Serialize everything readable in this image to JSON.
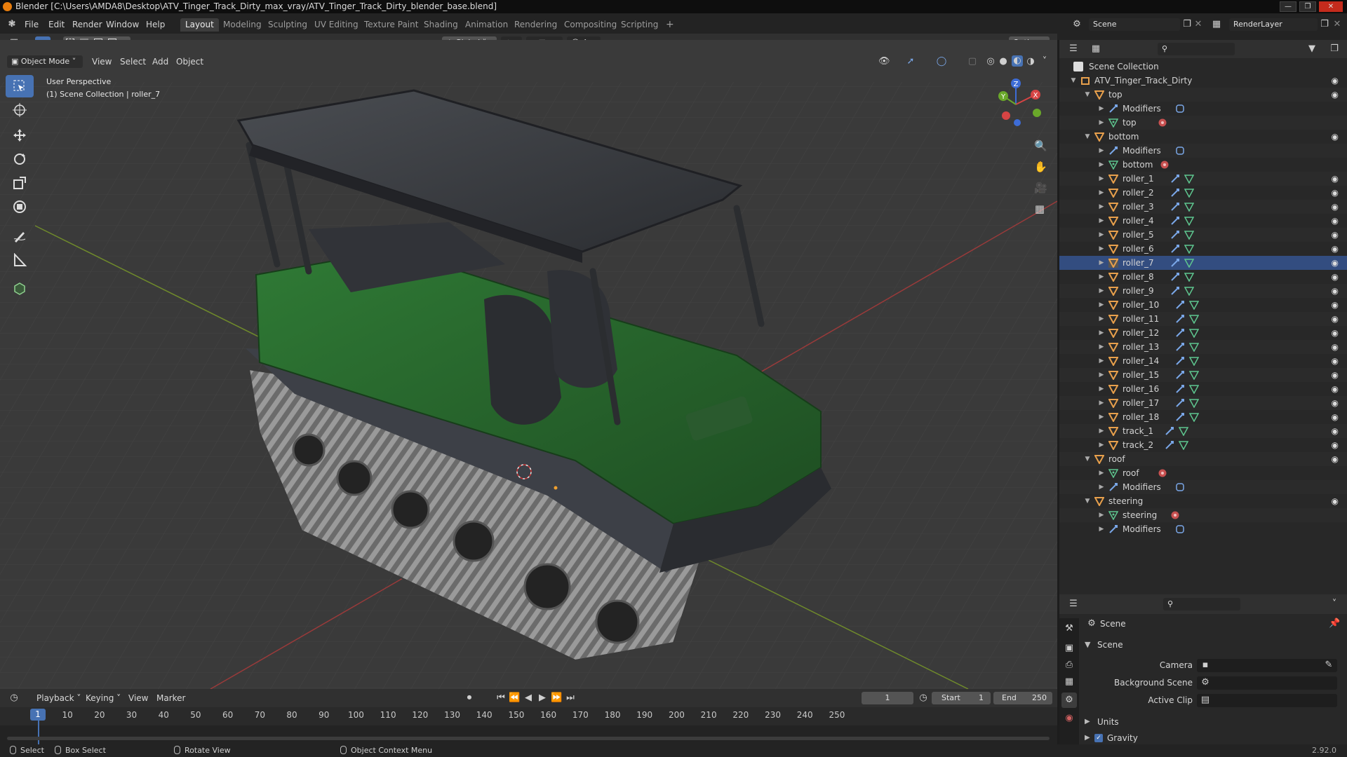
{
  "title_bar": {
    "text": "Blender [C:\\Users\\AMDA8\\Desktop\\ATV_Tinger_Track_Dirty_max_vray/ATV_Tinger_Track_Dirty_blender_base.blend]"
  },
  "menu": [
    "File",
    "Edit",
    "Render",
    "Window",
    "Help"
  ],
  "workspaces": [
    "Layout",
    "Modeling",
    "Sculpting",
    "UV Editing",
    "Texture Paint",
    "Shading",
    "Animation",
    "Rendering",
    "Compositing",
    "Scripting"
  ],
  "workspace_add": "+",
  "scene_selector": {
    "value": "Scene"
  },
  "view_layer_selector": {
    "value": "RenderLayer"
  },
  "tool_header": {
    "orientation": "Global",
    "options": "Options"
  },
  "viewport_header": {
    "mode": "Object Mode",
    "menus": [
      "View",
      "Select",
      "Add",
      "Object"
    ]
  },
  "viewport_overlay_text": {
    "line1": "User Perspective",
    "line2": "(1) Scene Collection | roller_7"
  },
  "gizmo": {
    "x": "X",
    "y": "Y",
    "z": "Z"
  },
  "outliner": {
    "root": "Scene Collection",
    "items": [
      {
        "label": "ATV_Tinger_Track_Dirty",
        "depth": 0,
        "type": "collection",
        "expanded": true,
        "eye": true
      },
      {
        "label": "top",
        "depth": 1,
        "type": "object",
        "expanded": true,
        "eye": true
      },
      {
        "label": "Modifiers",
        "depth": 2,
        "type": "modifiers",
        "expanded": false,
        "eye": false
      },
      {
        "label": "top",
        "depth": 2,
        "type": "mesh",
        "expanded": false,
        "eye": false
      },
      {
        "label": "bottom",
        "depth": 1,
        "type": "object",
        "expanded": true,
        "eye": true
      },
      {
        "label": "Modifiers",
        "depth": 2,
        "type": "modifiers",
        "expanded": false,
        "eye": false
      },
      {
        "label": "bottom",
        "depth": 2,
        "type": "mesh",
        "expanded": false,
        "eye": false
      },
      {
        "label": "roller_1",
        "depth": 2,
        "type": "object",
        "expanded": false,
        "eye": true
      },
      {
        "label": "roller_2",
        "depth": 2,
        "type": "object",
        "expanded": false,
        "eye": true
      },
      {
        "label": "roller_3",
        "depth": 2,
        "type": "object",
        "expanded": false,
        "eye": true
      },
      {
        "label": "roller_4",
        "depth": 2,
        "type": "object",
        "expanded": false,
        "eye": true
      },
      {
        "label": "roller_5",
        "depth": 2,
        "type": "object",
        "expanded": false,
        "eye": true
      },
      {
        "label": "roller_6",
        "depth": 2,
        "type": "object",
        "expanded": false,
        "eye": true
      },
      {
        "label": "roller_7",
        "depth": 2,
        "type": "object",
        "expanded": false,
        "eye": true,
        "active": true
      },
      {
        "label": "roller_8",
        "depth": 2,
        "type": "object",
        "expanded": false,
        "eye": true
      },
      {
        "label": "roller_9",
        "depth": 2,
        "type": "object",
        "expanded": false,
        "eye": true
      },
      {
        "label": "roller_10",
        "depth": 2,
        "type": "object",
        "expanded": false,
        "eye": true
      },
      {
        "label": "roller_11",
        "depth": 2,
        "type": "object",
        "expanded": false,
        "eye": true
      },
      {
        "label": "roller_12",
        "depth": 2,
        "type": "object",
        "expanded": false,
        "eye": true
      },
      {
        "label": "roller_13",
        "depth": 2,
        "type": "object",
        "expanded": false,
        "eye": true
      },
      {
        "label": "roller_14",
        "depth": 2,
        "type": "object",
        "expanded": false,
        "eye": true
      },
      {
        "label": "roller_15",
        "depth": 2,
        "type": "object",
        "expanded": false,
        "eye": true
      },
      {
        "label": "roller_16",
        "depth": 2,
        "type": "object",
        "expanded": false,
        "eye": true
      },
      {
        "label": "roller_17",
        "depth": 2,
        "type": "object",
        "expanded": false,
        "eye": true
      },
      {
        "label": "roller_18",
        "depth": 2,
        "type": "object",
        "expanded": false,
        "eye": true
      },
      {
        "label": "track_1",
        "depth": 2,
        "type": "object",
        "expanded": false,
        "eye": true
      },
      {
        "label": "track_2",
        "depth": 2,
        "type": "object",
        "expanded": false,
        "eye": true
      },
      {
        "label": "roof",
        "depth": 1,
        "type": "object",
        "expanded": true,
        "eye": true
      },
      {
        "label": "roof",
        "depth": 2,
        "type": "mesh",
        "expanded": false,
        "eye": false
      },
      {
        "label": "Modifiers",
        "depth": 2,
        "type": "modifiers",
        "expanded": false,
        "eye": false
      },
      {
        "label": "steering",
        "depth": 1,
        "type": "object",
        "expanded": true,
        "eye": true
      },
      {
        "label": "steering",
        "depth": 2,
        "type": "mesh",
        "expanded": false,
        "eye": false
      },
      {
        "label": "Modifiers",
        "depth": 2,
        "type": "modifiers",
        "expanded": false,
        "eye": false
      }
    ]
  },
  "properties": {
    "context": "Scene",
    "panel": "Scene",
    "fields": [
      {
        "label": "Camera",
        "value": ""
      },
      {
        "label": "Background Scene",
        "value": ""
      },
      {
        "label": "Active Clip",
        "value": ""
      }
    ],
    "collapsed_panels": [
      "Units",
      "Gravity"
    ]
  },
  "timeline": {
    "menus": [
      "Playback",
      "Keying",
      "View",
      "Marker"
    ],
    "current_frame": "1",
    "start_label": "Start",
    "start": "1",
    "end_label": "End",
    "end": "250",
    "ticks": [
      "1",
      "10",
      "20",
      "30",
      "40",
      "50",
      "60",
      "70",
      "80",
      "90",
      "100",
      "110",
      "120",
      "130",
      "140",
      "150",
      "160",
      "170",
      "180",
      "190",
      "200",
      "210",
      "220",
      "230",
      "240",
      "250"
    ]
  },
  "status_bar": {
    "select": "Select",
    "box_select": "Box Select",
    "rotate": "Rotate View",
    "context_menu": "Object Context Menu",
    "version": "2.92.0"
  },
  "colors": {
    "accent": "#4772b3",
    "object_orange": "#e8a04c",
    "mesh_green": "#5ec68f",
    "modifier_blue": "#7aa7e8",
    "vehicle_green": "#2e6b32"
  }
}
